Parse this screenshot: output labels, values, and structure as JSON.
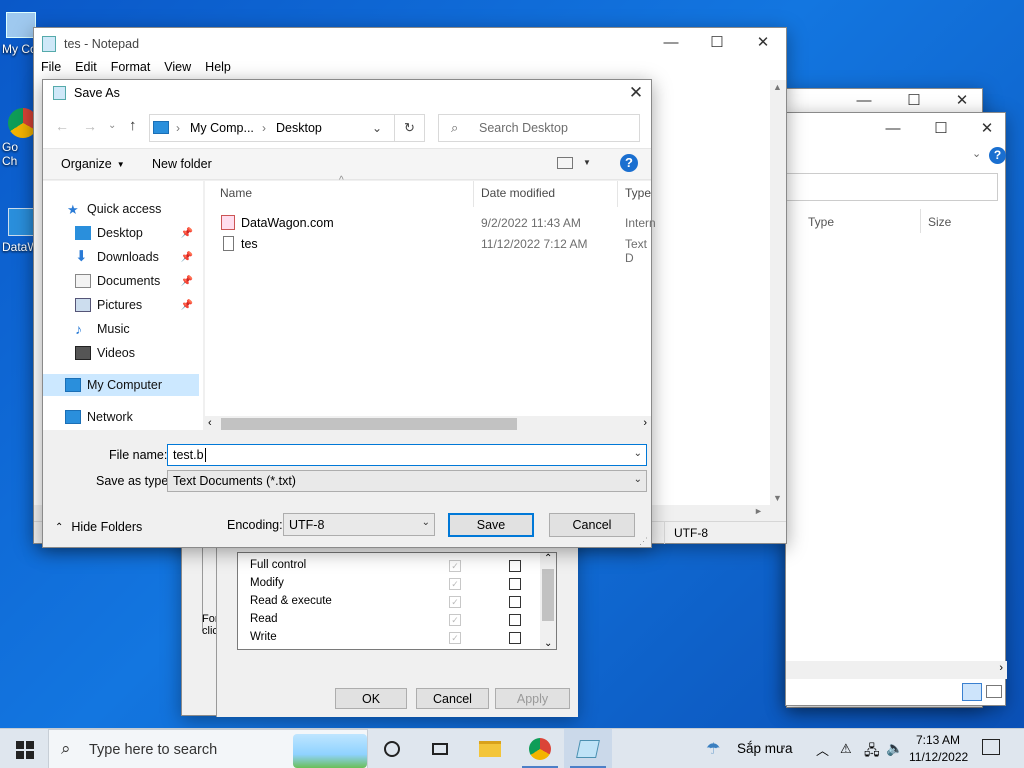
{
  "desktop": {
    "icons": [
      {
        "label": "My Co"
      },
      {
        "label": "Go\nCh"
      },
      {
        "label": "DataW"
      }
    ]
  },
  "notepad": {
    "title": "tes - Notepad",
    "menu": [
      "File",
      "Edit",
      "Format",
      "View",
      "Help"
    ],
    "status_encoding": "UTF-8"
  },
  "explorer": {
    "columns": [
      "Type",
      "Size"
    ]
  },
  "permissions": {
    "rows": [
      "Full control",
      "Modify",
      "Read & execute",
      "Read",
      "Write"
    ],
    "side_text": [
      "For",
      "clic"
    ],
    "buttons": {
      "ok": "OK",
      "cancel": "Cancel",
      "apply": "Apply"
    }
  },
  "saveas": {
    "title": "Save As",
    "breadcrumb": [
      "My Comp...",
      "Desktop"
    ],
    "search_placeholder": "Search Desktop",
    "toolbar": {
      "organize": "Organize",
      "new_folder": "New folder"
    },
    "nav": [
      {
        "label": "Quick access"
      },
      {
        "label": "Desktop"
      },
      {
        "label": "Downloads"
      },
      {
        "label": "Documents"
      },
      {
        "label": "Pictures"
      },
      {
        "label": "Music"
      },
      {
        "label": "Videos"
      },
      {
        "label": "My Computer"
      },
      {
        "label": "Network"
      }
    ],
    "columns": {
      "name": "Name",
      "date": "Date modified",
      "type": "Type"
    },
    "files": [
      {
        "name": "DataWagon.com",
        "date": "9/2/2022 11:43 AM",
        "type": "Intern"
      },
      {
        "name": "tes",
        "date": "11/12/2022 7:12 AM",
        "type": "Text D"
      }
    ],
    "file_name_label": "File name:",
    "file_name_value": "test.b",
    "save_type_label": "Save as type:",
    "save_type_value": "Text Documents (*.txt)",
    "hide_folders": "Hide Folders",
    "encoding_label": "Encoding:",
    "encoding_value": "UTF-8",
    "save_button": "Save",
    "cancel_button": "Cancel"
  },
  "taskbar": {
    "search_placeholder": "Type here to search",
    "weather": "Sắp mưa",
    "time": "7:13 AM",
    "date": "11/12/2022"
  }
}
